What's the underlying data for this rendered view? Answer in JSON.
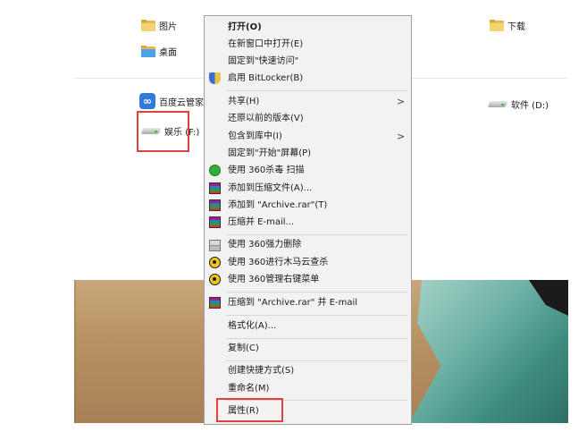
{
  "explorer": {
    "items": {
      "pictures": "图片",
      "desktop": "桌面",
      "downloads": "下载",
      "baidu": "百度云管家",
      "software_drive": "软件 (D:)",
      "entertainment_drive": "娱乐 (F:)"
    }
  },
  "context_menu": {
    "open": "打开(O)",
    "open_new_window": "在新窗口中打开(E)",
    "pin_quick_access": "固定到\"快速访问\"",
    "bitlocker": "启用 BitLocker(B)",
    "share": "共享(H)",
    "restore_previous": "还原以前的版本(V)",
    "include_library": "包含到库中(I)",
    "pin_start": "固定到\"开始\"屏幕(P)",
    "scan_360": "使用 360杀毒 扫描",
    "add_archive": "添加到压缩文件(A)...",
    "add_archive_rar": "添加到 \"Archive.rar\"(T)",
    "compress_email": "压缩并 E-mail...",
    "force_delete_360": "使用 360强力删除",
    "trojan_scan_360": "使用 360进行木马云查杀",
    "manage_menu_360": "使用 360管理右键菜单",
    "compress_rar_email": "压缩到 \"Archive.rar\" 并 E-mail",
    "format": "格式化(A)...",
    "copy": "复制(C)",
    "create_shortcut": "创建快捷方式(S)",
    "rename": "重命名(M)",
    "properties": "属性(R)"
  },
  "colors": {
    "highlight": "#e04040",
    "menu_bg": "#f2f2f2"
  }
}
